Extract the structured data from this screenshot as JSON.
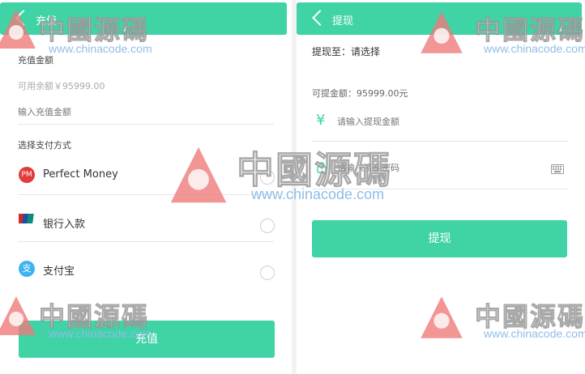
{
  "left": {
    "title": "充值",
    "amount_section_label": "充值金额",
    "available_balance": "可用余额￥95999.00",
    "amount_placeholder": "输入充值金额",
    "payment_section_label": "选择支付方式",
    "payment_methods": [
      {
        "label": "Perfect Money",
        "icon": "perfect-money-icon",
        "icon_text": "PM",
        "color": "#e23b3b"
      },
      {
        "label": "银行入款",
        "icon": "unionpay-icon",
        "color": "#2a63b5"
      },
      {
        "label": "支付宝",
        "icon": "alipay-icon",
        "icon_text": "支",
        "color": "#3fb3f0"
      }
    ],
    "submit_label": "充值"
  },
  "right": {
    "title": "提现",
    "withdraw_to": "提现至：请选择",
    "available_amount": "可提金额：95999.00元",
    "amount_icon": "yen-icon",
    "amount_placeholder": "请输入提现金额",
    "password_placeholder": "请输入资金密码",
    "keyboard_icon": "keyboard-icon",
    "submit_label": "提现"
  },
  "watermark": {
    "text": "中國源碼",
    "url": "www.chinacode.com"
  },
  "colors": {
    "accent": "#3fd3a6"
  }
}
